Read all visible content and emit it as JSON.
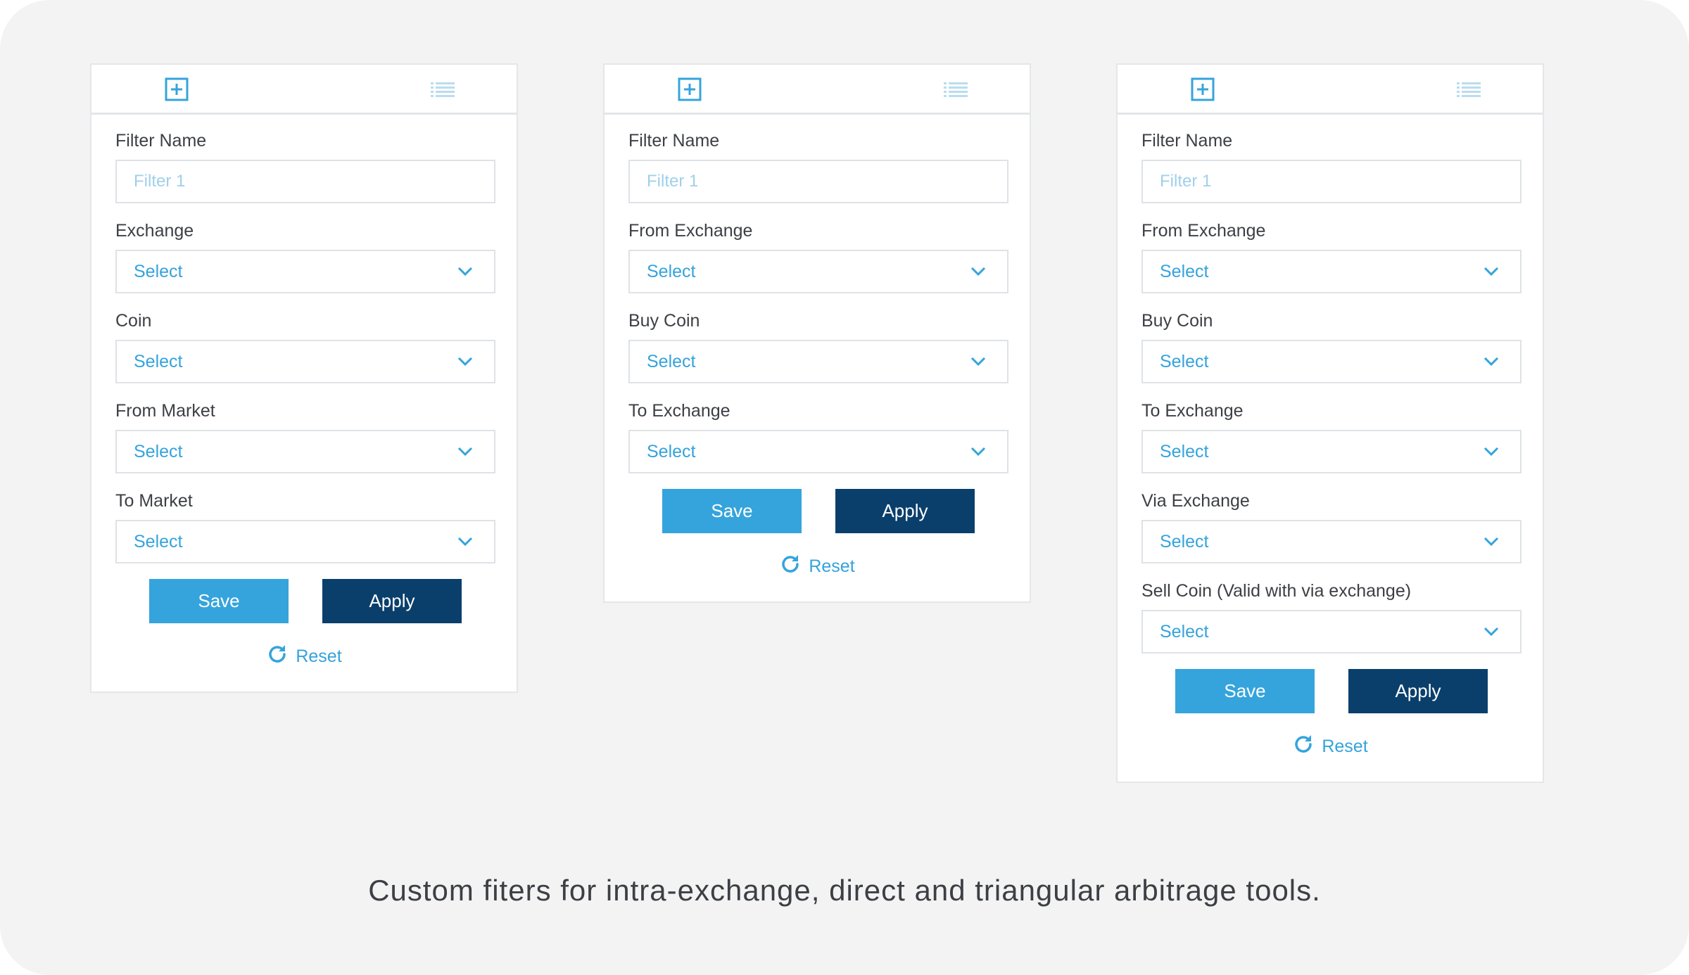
{
  "colors": {
    "background": "#f3f3f3",
    "panel_border": "#e4e6e9",
    "accent": "#35a4dc",
    "apply_button": "#0a3f6c",
    "label_text": "#3c3f44",
    "placeholder": "#9fd0ea"
  },
  "panels": [
    {
      "header": {
        "add_icon": "plus-square-icon",
        "list_icon": "list-icon"
      },
      "filter_name": {
        "label": "Filter Name",
        "placeholder": "Filter 1",
        "value": ""
      },
      "selects": [
        {
          "label": "Exchange",
          "value": "Select"
        },
        {
          "label": "Coin",
          "value": "Select"
        },
        {
          "label": "From Market",
          "value": "Select"
        },
        {
          "label": "To Market",
          "value": "Select"
        }
      ],
      "save_label": "Save",
      "apply_label": "Apply",
      "reset_label": "Reset"
    },
    {
      "header": {
        "add_icon": "plus-square-icon",
        "list_icon": "list-icon"
      },
      "filter_name": {
        "label": "Filter Name",
        "placeholder": "Filter 1",
        "value": ""
      },
      "selects": [
        {
          "label": "From Exchange",
          "value": "Select"
        },
        {
          "label": "Buy Coin",
          "value": "Select"
        },
        {
          "label": "To Exchange",
          "value": "Select"
        }
      ],
      "save_label": "Save",
      "apply_label": "Apply",
      "reset_label": "Reset"
    },
    {
      "header": {
        "add_icon": "plus-square-icon",
        "list_icon": "list-icon"
      },
      "filter_name": {
        "label": "Filter Name",
        "placeholder": "Filter 1",
        "value": ""
      },
      "selects": [
        {
          "label": "From Exchange",
          "value": "Select"
        },
        {
          "label": "Buy Coin",
          "value": "Select"
        },
        {
          "label": "To Exchange",
          "value": "Select"
        },
        {
          "label": "Via Exchange",
          "value": "Select"
        },
        {
          "label": "Sell Coin (Valid with via exchange)",
          "value": "Select"
        }
      ],
      "save_label": "Save",
      "apply_label": "Apply",
      "reset_label": "Reset"
    }
  ],
  "caption": "Custom fiters for intra-exchange, direct and triangular arbitrage tools."
}
